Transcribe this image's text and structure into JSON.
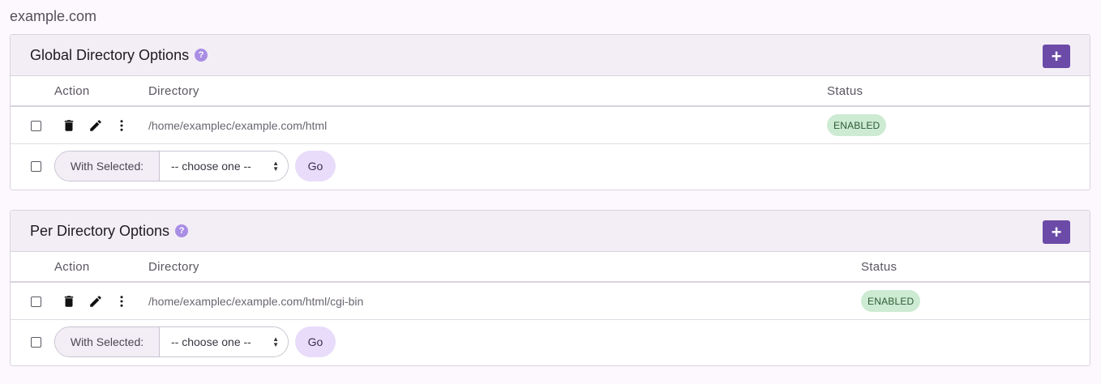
{
  "domain": "example.com",
  "panels": [
    {
      "title": "Global Directory Options",
      "help_icon": "?",
      "add_icon": "+",
      "headers": {
        "action": "Action",
        "directory": "Directory",
        "status": "Status"
      },
      "row": {
        "directory": "/home/examplec/example.com/html",
        "status": "ENABLED"
      },
      "bulk": {
        "label": "With Selected:",
        "select_value": "-- choose one --",
        "go": "Go"
      }
    },
    {
      "title": "Per Directory Options",
      "help_icon": "?",
      "add_icon": "+",
      "headers": {
        "action": "Action",
        "directory": "Directory",
        "status": "Status"
      },
      "row": {
        "directory": "/home/examplec/example.com/html/cgi-bin",
        "status": "ENABLED"
      },
      "bulk": {
        "label": "With Selected:",
        "select_value": "-- choose one --",
        "go": "Go"
      }
    }
  ],
  "colors": {
    "accent": "#6b4aa8",
    "enabled_badge": "#cdebd2",
    "go_button": "#e8dcfa"
  },
  "icons": [
    "trash-icon",
    "pencil-icon",
    "more-vertical-icon",
    "help-icon",
    "plus-icon",
    "select-arrows-icon"
  ]
}
